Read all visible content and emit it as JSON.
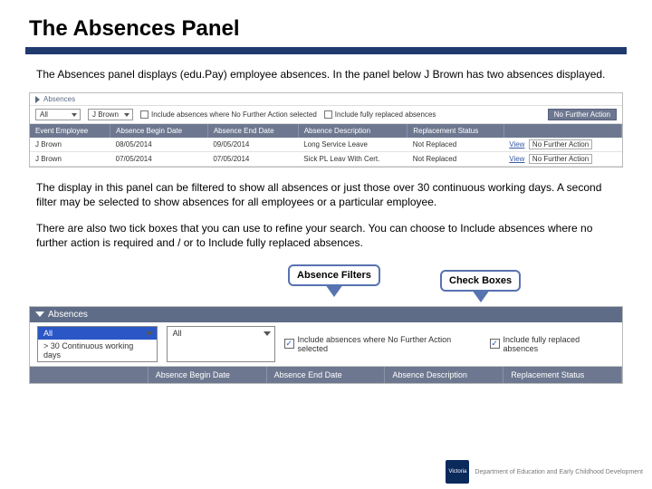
{
  "title": "The Absences Panel",
  "intro": "The Absences panel displays (edu.Pay) employee absences. In the panel below J Brown has two absences displayed.",
  "panel1": {
    "header": "Absences",
    "filter_all": "All",
    "filter_emp": "J Brown",
    "chk1_label": "Include absences where No Further Action selected",
    "chk2_label": "Include fully replaced absences",
    "nfa_btn": "No Further Action",
    "columns": [
      "Event Employee",
      "Absence Begin Date",
      "Absence End Date",
      "Absence Description",
      "Replacement Status",
      ""
    ],
    "rows": [
      {
        "emp": "J Brown",
        "begin": "08/05/2014",
        "end": "09/05/2014",
        "desc": "Long Service Leave",
        "status": "Not Replaced",
        "link": "View",
        "action": "No Further Action"
      },
      {
        "emp": "J Brown",
        "begin": "07/05/2014",
        "end": "07/05/2014",
        "desc": "Sick PL Leav With Cert.",
        "status": "Not Replaced",
        "link": "View",
        "action": "No Further Action"
      }
    ]
  },
  "para2": "The display in this panel can be filtered to show all absences or just those over 30 continuous working days.  A second filter may be selected to show absences for all employees or a particular employee.",
  "para3": "There are also two tick boxes that you can use to refine your search. You can choose to Include absences where no further action is required and / or to Include fully replaced absences.",
  "callout1": "Absence Filters",
  "callout2": "Check Boxes",
  "panel2": {
    "header": "Absences",
    "dd_open_sel": "All",
    "dd_open_opt": "> 30 Continuous working days",
    "dd2_val": "All",
    "chk1_label": "Include absences where No Further Action selected",
    "chk2_label": "Include fully replaced absences",
    "columns": [
      "",
      "Absence Begin Date",
      "Absence End Date",
      "Absence Description",
      "Replacement Status"
    ]
  },
  "footer": {
    "badge": "Victoria",
    "text": "Department of Education and Early Childhood Development"
  }
}
